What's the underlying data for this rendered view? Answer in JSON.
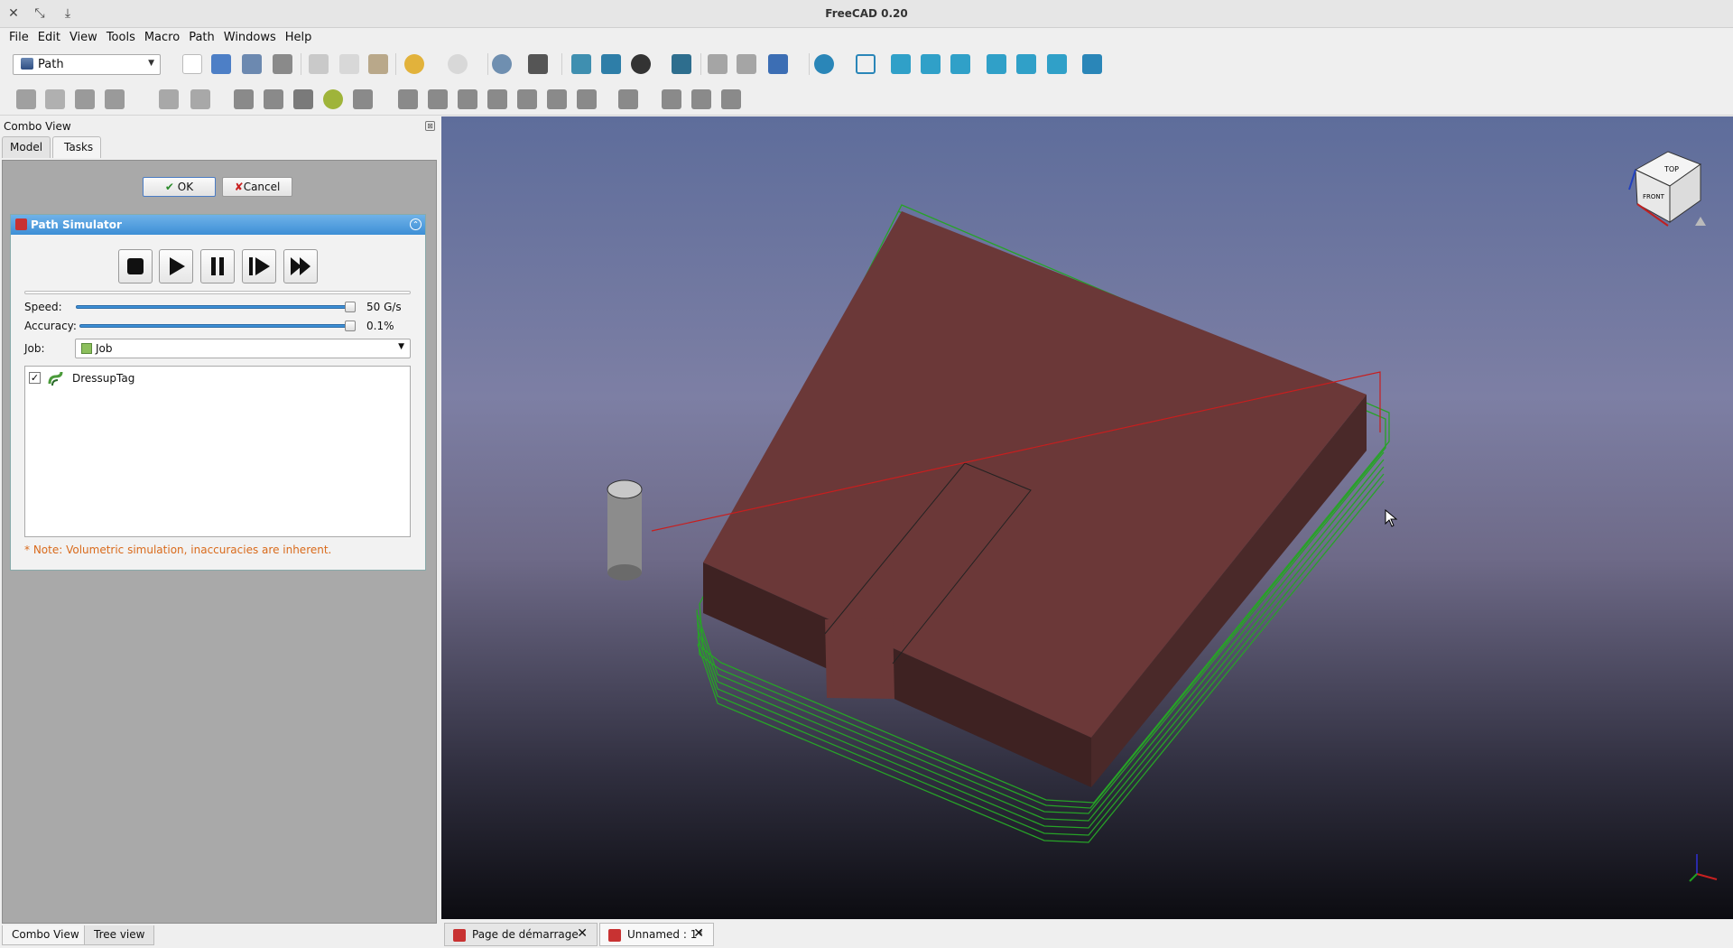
{
  "window": {
    "title": "FreeCAD 0.20"
  },
  "menu": [
    "File",
    "Edit",
    "View",
    "Tools",
    "Macro",
    "Path",
    "Windows",
    "Help"
  ],
  "workbench": {
    "selected": "Path"
  },
  "combo_view": {
    "title": "Combo View",
    "tabs": [
      "Model",
      "Tasks"
    ],
    "active_tab": "Tasks",
    "ok_label": "OK",
    "cancel_label": "Cancel"
  },
  "path_simulator": {
    "title": "Path Simulator",
    "speed_label": "Speed:",
    "speed_value": "50 G/s",
    "speed_fraction": 1.0,
    "accuracy_label": "Accuracy:",
    "accuracy_value": "0.1%",
    "accuracy_fraction": 1.0,
    "job_label": "Job:",
    "job_value": "Job",
    "operations": [
      {
        "label": "DressupTag",
        "checked": true
      }
    ],
    "note": "* Note: Volumetric simulation, inaccuracies are inherent."
  },
  "bottom_tabs": [
    "Combo View",
    "Tree view"
  ],
  "doc_tabs": [
    "Page de démarrage",
    "Unnamed : 1*"
  ],
  "navcube": {
    "top": "TOP",
    "front": "FRONT"
  },
  "colors": {
    "part": "#6b3838",
    "toolpath": "#27a327",
    "rapid": "#c81e1e",
    "accent": "#3d8fd6"
  }
}
